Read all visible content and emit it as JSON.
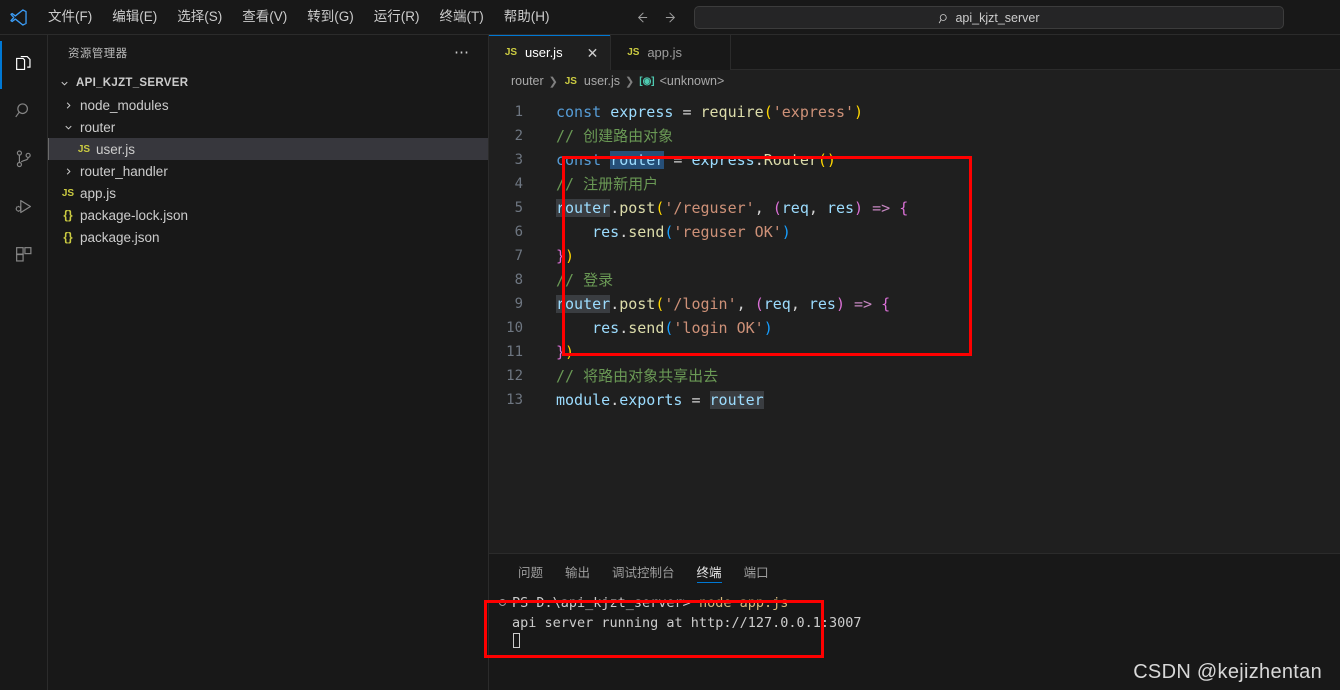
{
  "titlebar": {
    "logo_icon": "vscode-logo-icon",
    "menus": [
      {
        "label": "文件(F)"
      },
      {
        "label": "编辑(E)"
      },
      {
        "label": "选择(S)"
      },
      {
        "label": "查看(V)"
      },
      {
        "label": "转到(G)"
      },
      {
        "label": "运行(R)"
      },
      {
        "label": "终端(T)"
      },
      {
        "label": "帮助(H)"
      }
    ],
    "nav": {
      "back_icon": "arrow-left-icon",
      "forward_icon": "arrow-right-icon"
    },
    "search": {
      "icon": "search-icon",
      "value": "api_kjzt_server",
      "placeholder": "api_kjzt_server"
    }
  },
  "activitybar": {
    "items": [
      {
        "name": "explorer",
        "icon": "files-icon",
        "active": true
      },
      {
        "name": "search",
        "icon": "search-icon",
        "active": false
      },
      {
        "name": "source-control",
        "icon": "source-control-icon",
        "active": false
      },
      {
        "name": "run-debug",
        "icon": "run-debug-icon",
        "active": false
      },
      {
        "name": "extensions",
        "icon": "extensions-icon",
        "active": false
      }
    ]
  },
  "sidebar": {
    "title": "资源管理器",
    "more_icon": "more-actions-icon",
    "root": {
      "label": "API_KJZT_SERVER",
      "expanded": true,
      "chevron": "chevron-down-icon"
    },
    "items": [
      {
        "label": "node_modules",
        "type": "folder",
        "expanded": false,
        "indent": 1,
        "selected": false
      },
      {
        "label": "router",
        "type": "folder",
        "expanded": true,
        "indent": 1,
        "selected": false
      },
      {
        "label": "user.js",
        "type": "js",
        "indent": 2,
        "selected": true
      },
      {
        "label": "router_handler",
        "type": "folder",
        "expanded": false,
        "indent": 1,
        "selected": false
      },
      {
        "label": "app.js",
        "type": "js",
        "indent": 1,
        "selected": false
      },
      {
        "label": "package-lock.json",
        "type": "json",
        "indent": 1,
        "selected": false
      },
      {
        "label": "package.json",
        "type": "json",
        "indent": 1,
        "selected": false
      }
    ]
  },
  "editor": {
    "tabs": [
      {
        "label": "user.js",
        "icon": "js-file-icon",
        "active": true,
        "close_icon": "close-icon"
      },
      {
        "label": "app.js",
        "icon": "js-file-icon",
        "active": false
      }
    ],
    "breadcrumb": [
      {
        "label": "router",
        "type": "folder"
      },
      {
        "label": "user.js",
        "type": "js"
      },
      {
        "label": "<unknown>",
        "type": "symbol"
      }
    ],
    "line_numbers": [
      "1",
      "2",
      "3",
      "4",
      "5",
      "6",
      "7",
      "8",
      "9",
      "10",
      "11",
      "12",
      "13"
    ],
    "code_lines": [
      "const express = require('express')",
      "// 创建路由对象",
      "const router = express.Router()",
      "// 注册新用户",
      "router.post('/reguser', (req, res) => {",
      "    res.send('reguser OK')",
      "})",
      "// 登录",
      "router.post('/login', (req, res) => {",
      "    res.send('login OK')",
      "})",
      "// 将路由对象共享出去",
      "module.exports = router"
    ],
    "annotation_box_color": "#fe0000"
  },
  "panel": {
    "tabs": [
      {
        "label": "问题",
        "active": false
      },
      {
        "label": "输出",
        "active": false
      },
      {
        "label": "调试控制台",
        "active": false
      },
      {
        "label": "终端",
        "active": true
      },
      {
        "label": "端口",
        "active": false
      }
    ],
    "terminal": {
      "prompt": "PS D:\\api_kjzt_server> ",
      "command": "node app.js",
      "output": "api server running at http://127.0.0.1:3007",
      "status_icon": "terminal-status-icon"
    }
  },
  "watermark": {
    "text": "CSDN @kejizhentan"
  }
}
